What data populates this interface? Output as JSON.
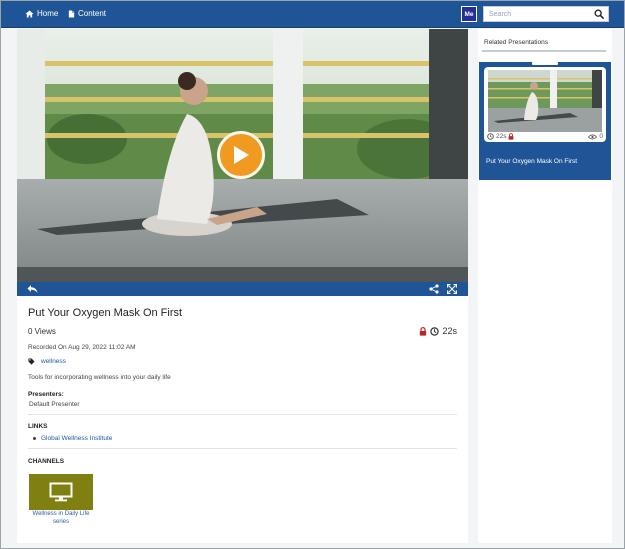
{
  "nav": {
    "home_label": "Home",
    "content_label": "Content",
    "user_badge": "Me",
    "search_placeholder": "Search"
  },
  "video": {
    "title": "Put Your Oxygen Mask On First",
    "views": "0 Views",
    "duration": "22s",
    "recorded": "Recorded On Aug 29, 2022 11:02 AM",
    "tag": "wellness",
    "description": "Tools for incorporating wellness into your daily life",
    "presenters_label": "Presenters:",
    "presenter": "Default Presenter",
    "links_label": "LINKS",
    "links": [
      "Global Wellness Institute"
    ],
    "channels_label": "CHANNELS",
    "channel_name": "Wellness in Daily Life series"
  },
  "related": {
    "heading": "Related Presentations",
    "item": {
      "title": "Put Your Oxygen Mask On First",
      "duration": "22s",
      "views": "0"
    }
  },
  "colors": {
    "nav_blue": "#1f5596",
    "play_orange": "#f09a21",
    "lock_red": "#b8252b",
    "channel_olive": "#7f7f12",
    "link_blue": "#1f5aa8"
  },
  "icons": [
    "home-icon",
    "document-icon",
    "search-icon",
    "play-icon",
    "back-icon",
    "share-icon",
    "fullscreen-icon",
    "lock-icon",
    "clock-icon",
    "tag-icon",
    "monitor-icon",
    "eye-icon"
  ]
}
